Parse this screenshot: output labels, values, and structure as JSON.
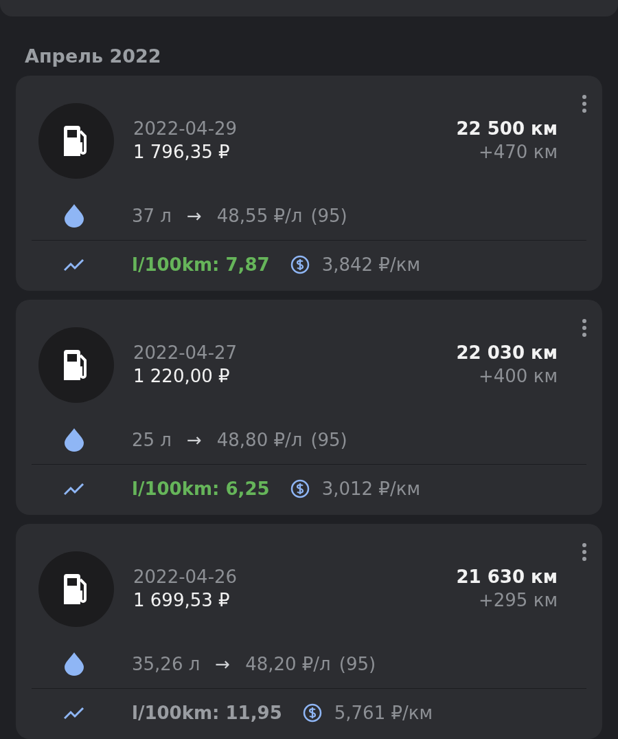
{
  "month_header": "Апрель 2022",
  "refuels": [
    {
      "date": "2022-04-29",
      "cost": "1 796,35 ₽",
      "odometer": "22 500 км",
      "distance": "+470 км",
      "volume": "37 л",
      "arrow": "→",
      "unit_price": "48,55 ₽/л",
      "grade": "(95)",
      "consumption": "l/100km: 7,87",
      "color": "#66b55a",
      "cost_per_km": "3,842 ₽/км"
    },
    {
      "date": "2022-04-27",
      "cost": "1 220,00 ₽",
      "odometer": "22 030 км",
      "distance": "+400 км",
      "volume": "25 л",
      "arrow": "→",
      "unit_price": "48,80 ₽/л",
      "grade": "(95)",
      "consumption": "l/100km: 6,25",
      "color": "#66b55a",
      "cost_per_km": "3,012 ₽/км"
    },
    {
      "date": "2022-04-26",
      "cost": "1 699,53 ₽",
      "odometer": "21 630 км",
      "distance": "+295 км",
      "volume": "35,26 л",
      "arrow": "→",
      "unit_price": "48,20 ₽/л",
      "grade": "(95)",
      "consumption": "l/100km: 11,95",
      "color": "#9a9da2",
      "cost_per_km": "5,761 ₽/км"
    }
  ]
}
